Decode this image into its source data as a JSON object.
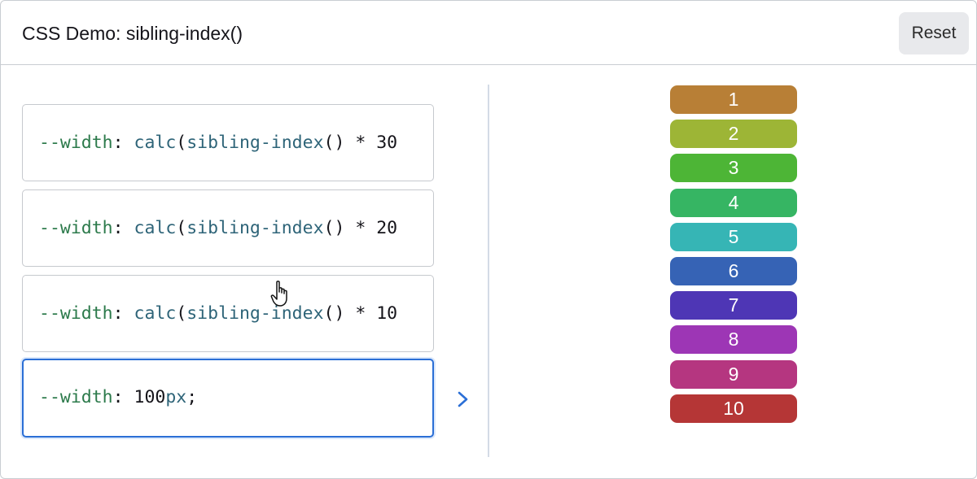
{
  "header": {
    "title": "CSS Demo: sibling-index()",
    "reset_label": "Reset"
  },
  "editors": [
    {
      "prop": "--width",
      "colon": ": ",
      "fn": "calc",
      "paren_open": "(",
      "inner_fn": "sibling-index",
      "inner_parens": "()",
      "rest": " * 30"
    },
    {
      "prop": "--width",
      "colon": ": ",
      "fn": "calc",
      "paren_open": "(",
      "inner_fn": "sibling-index",
      "inner_parens": "()",
      "rest": " * 20"
    },
    {
      "prop": "--width",
      "colon": ": ",
      "fn": "calc",
      "paren_open": "(",
      "inner_fn": "sibling-index",
      "inner_parens": "()",
      "rest": " * 10"
    },
    {
      "prop": "--width",
      "colon": ": ",
      "num": "100",
      "unit": "px",
      "semi": ";"
    }
  ],
  "active_editor_index": 3,
  "active_indicator_icon": "chevron-right-icon",
  "cursor_icon": "hand-pointer-icon",
  "output_items": [
    {
      "label": "1",
      "color": "#b87f36"
    },
    {
      "label": "2",
      "color": "#9db536"
    },
    {
      "label": "3",
      "color": "#4db536"
    },
    {
      "label": "4",
      "color": "#36b563"
    },
    {
      "label": "5",
      "color": "#36b5b5"
    },
    {
      "label": "6",
      "color": "#3663b5"
    },
    {
      "label": "7",
      "color": "#4e36b5"
    },
    {
      "label": "8",
      "color": "#9d36b5"
    },
    {
      "label": "9",
      "color": "#b53680"
    },
    {
      "label": "10",
      "color": "#b53636"
    }
  ],
  "colors": {
    "accent": "#2b6fd6",
    "property": "#2c7a4b",
    "function": "#2e6478"
  }
}
